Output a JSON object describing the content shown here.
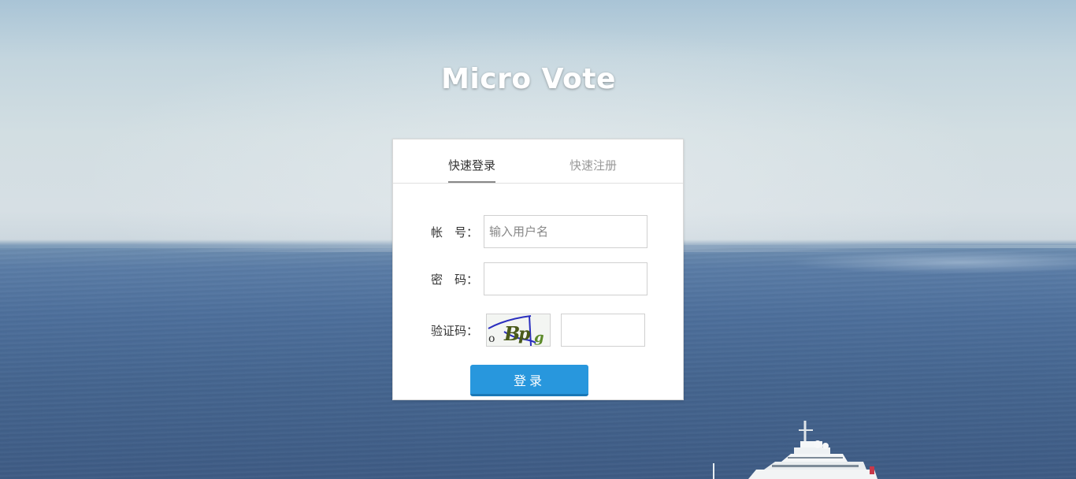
{
  "app": {
    "title": "Micro Vote"
  },
  "tabs": [
    {
      "label": "快速登录",
      "active": true
    },
    {
      "label": "快速注册",
      "active": false
    }
  ],
  "form": {
    "account_label": "帐　号：",
    "account_placeholder": "输入用户名",
    "account_value": "",
    "password_label": "密　码：",
    "password_value": "",
    "captcha_label": "验证码：",
    "captcha_text": "oBpg",
    "captcha_value": "",
    "submit_label": "登录"
  },
  "colors": {
    "primary_button": "#2897dd",
    "active_tab_underline": "#888888"
  }
}
